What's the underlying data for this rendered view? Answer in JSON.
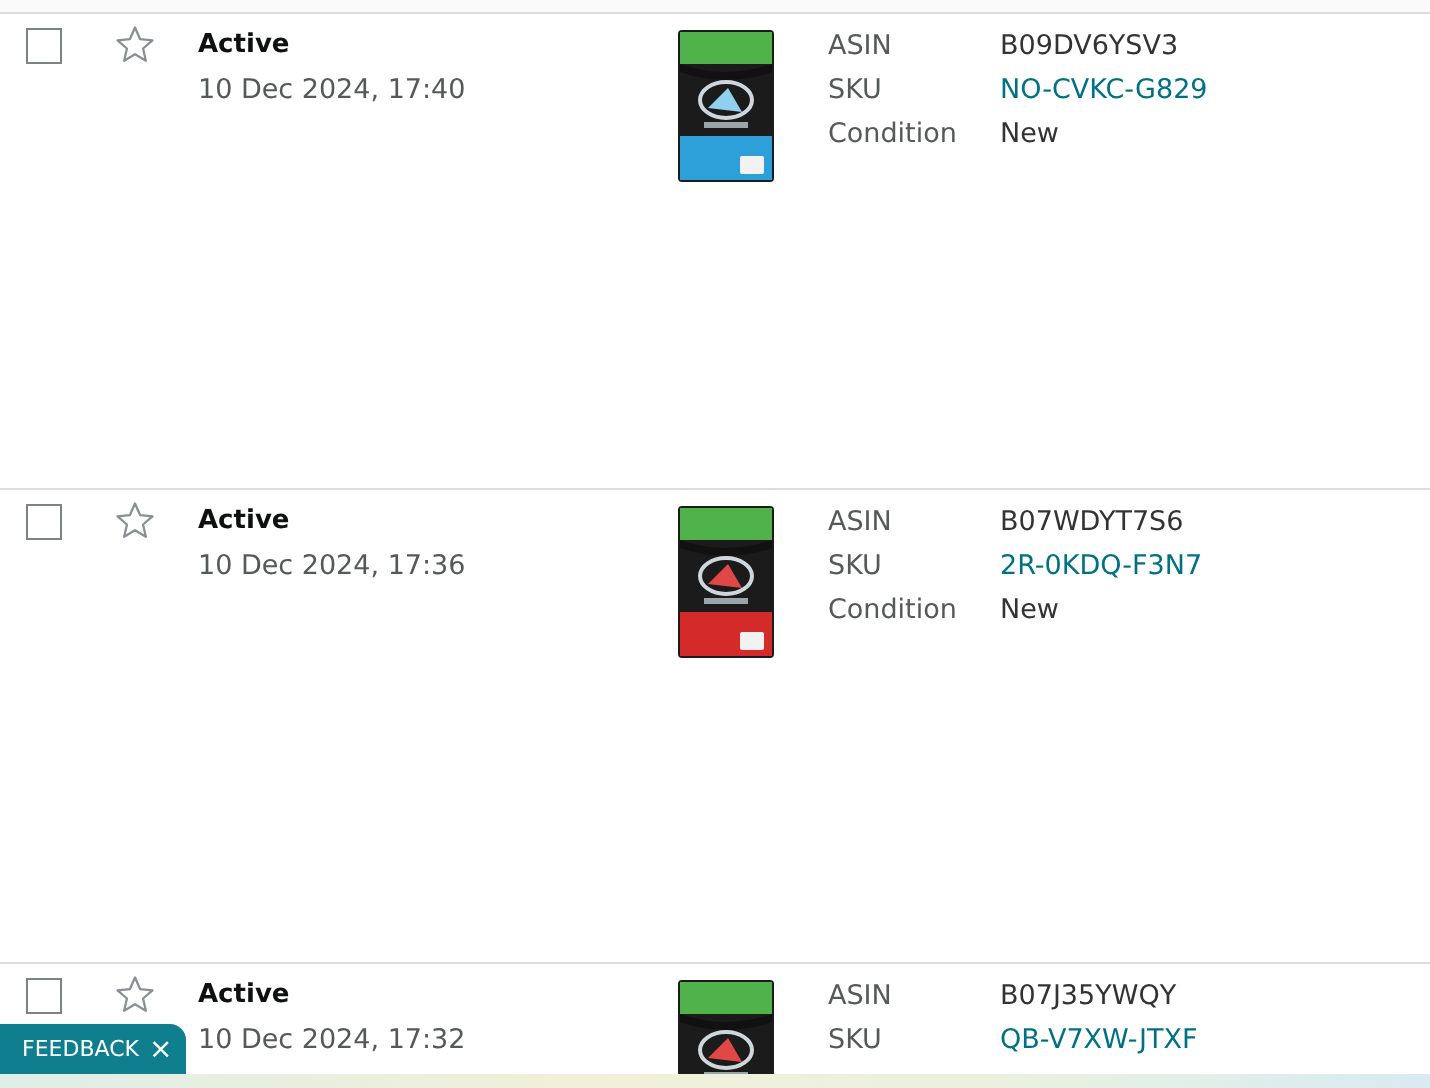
{
  "listings": [
    {
      "checked": false,
      "starred": false,
      "status": "Active",
      "date": "10 Dec 2024, 17:40",
      "image": {
        "kind": "picture"
      },
      "fields": [
        {
          "kind": "text",
          "label": "ASIN",
          "value": "B09DV6YSV3"
        },
        {
          "kind": "link",
          "label": "SKU",
          "value": "NO-CVKC-G829"
        },
        {
          "kind": "text",
          "label": "Condition",
          "value": "New"
        }
      ]
    },
    {
      "checked": false,
      "starred": false,
      "status": "Active",
      "date": "10 Dec 2024, 17:36",
      "image": {
        "kind": "picture"
      },
      "fields": [
        {
          "kind": "text",
          "label": "ASIN",
          "value": "B07WDYT7S6"
        },
        {
          "kind": "link",
          "label": "SKU",
          "value": "2R-0KDQ-F3N7"
        },
        {
          "kind": "text",
          "label": "Condition",
          "value": "New"
        }
      ]
    },
    {
      "checked": false,
      "starred": false,
      "status": "Active",
      "date": "10 Dec 2024, 17:32",
      "image": {
        "kind": "picture"
      },
      "fields": [
        {
          "kind": "text",
          "label": "ASIN",
          "value": "B07J35YWQY"
        },
        {
          "kind": "link",
          "label": "SKU",
          "value": "QB-V7XW-JTXF"
        }
      ]
    }
  ],
  "feedback": {
    "label": "FEEDBACK",
    "close": "×"
  }
}
